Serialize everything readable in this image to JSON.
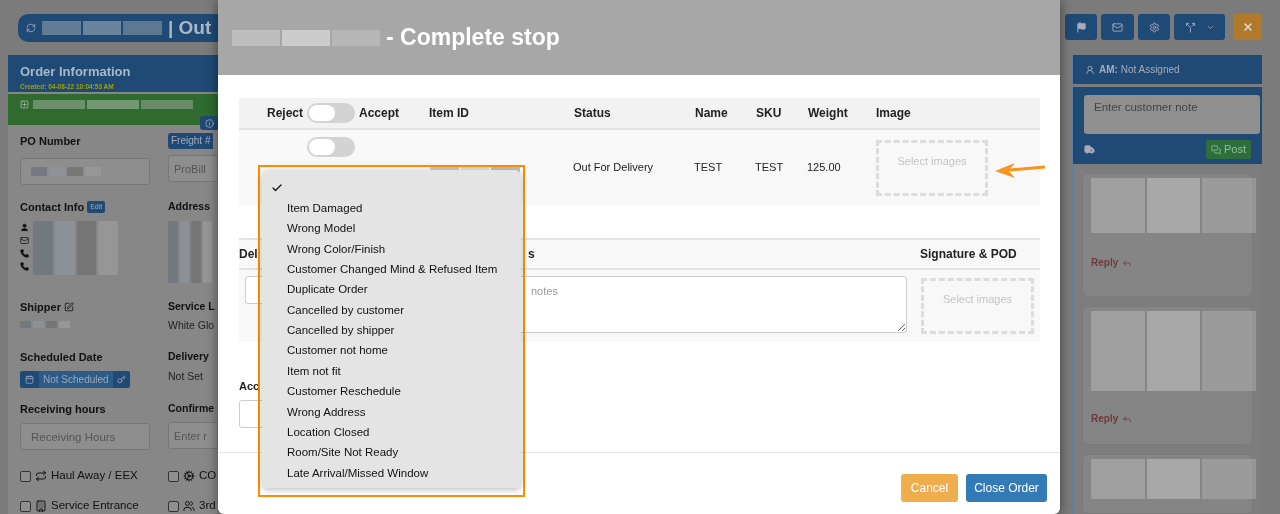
{
  "app_header": {
    "title": "| Out"
  },
  "order_panel": {
    "title": "Order Information",
    "created": "Created: 04-08-22 10:04:53 AM",
    "po_number": {
      "label": "PO Number"
    },
    "freight": {
      "badge": "Freight #",
      "placeholder": "ProBill"
    },
    "contact_info": {
      "label": "Contact Info",
      "edit": "Edit"
    },
    "address": {
      "label": "Address"
    },
    "shipper": {
      "label": "Shipper"
    },
    "service_level": {
      "label": "Service L",
      "value": "White Glo"
    },
    "scheduled_date": {
      "label": "Scheduled Date",
      "value": "Not Scheduled"
    },
    "delivery": {
      "label": "Delivery",
      "value": "Not Set"
    },
    "receiving_hours": {
      "label": "Receiving hours",
      "placeholder": "Receiving Hours"
    },
    "confirmed": {
      "label": "Confirme",
      "placeholder": "Enter r"
    },
    "options": [
      {
        "label": "Haul Away / EEX",
        "checked": false
      },
      {
        "label": "CO",
        "checked": false
      },
      {
        "label": "Service Entrance",
        "checked": false
      },
      {
        "label": "3rd",
        "checked": false
      }
    ]
  },
  "notes_panel": {
    "account_manager": "**AM:** Not Assigned",
    "note_placeholder": "Enter customer note",
    "post": "Post",
    "notes": [
      {
        "reply": "Reply"
      },
      {
        "reply": "Reply"
      }
    ]
  },
  "modal": {
    "title": "- Complete stop",
    "items_table": {
      "reject": "Reject",
      "accept": "Accept",
      "header_toggle": {
        "on": false
      },
      "columns": [
        "Item ID",
        "Status",
        "Name",
        "SKU",
        "Weight",
        "Image"
      ],
      "rows": [
        {
          "accepted": false,
          "status": "Out For Delivery",
          "name": "TEST",
          "sku": "TEST",
          "weight": "125.00",
          "image_placeholder": "Select images"
        }
      ]
    },
    "delivery_table": {
      "columns": [
        "Del",
        "s",
        "Signature & POD"
      ],
      "notes_placeholder": "notes",
      "signature_placeholder": "Select images"
    },
    "acc_label": "Acc",
    "reason_menu": {
      "options": [
        {
          "selected": true
        },
        {
          "label": "Item Damaged",
          "selected": false
        },
        {
          "label": "Wrong Model",
          "selected": false
        },
        {
          "label": "Wrong Color/Finish",
          "selected": false
        },
        {
          "label": "Customer Changed Mind & Refused Item",
          "selected": false
        },
        {
          "label": "Duplicate Order",
          "selected": false
        },
        {
          "label": "Cancelled by customer",
          "selected": false
        },
        {
          "label": "Cancelled by shipper",
          "selected": false
        },
        {
          "label": "Customer not home",
          "selected": false
        },
        {
          "label": "Item not fit",
          "selected": false
        },
        {
          "label": "Customer Reschedule",
          "selected": false
        },
        {
          "label": "Wrong Address",
          "selected": false
        },
        {
          "label": "Location Closed",
          "selected": false
        },
        {
          "label": "Room/Site Not Ready",
          "selected": false
        },
        {
          "label": "Late Arrival/Missed Window",
          "selected": false
        }
      ]
    },
    "buttons": [
      {
        "label": "Cancel",
        "kind": "warning"
      },
      {
        "label": "Close Order",
        "kind": "primary"
      }
    ]
  }
}
